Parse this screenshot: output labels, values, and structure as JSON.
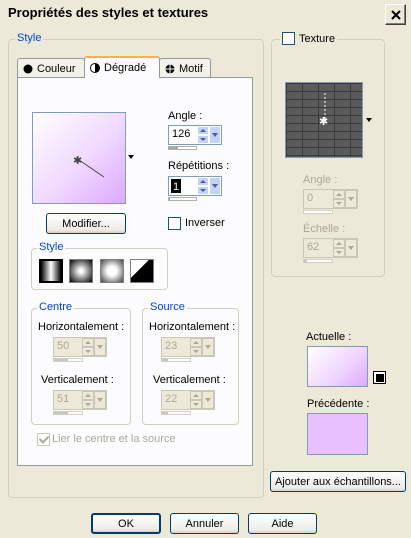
{
  "window": {
    "title": "Propriétés des styles et textures"
  },
  "style_group": {
    "label": "Style"
  },
  "tabs": [
    {
      "label": "Couleur",
      "icon": "circle-icon",
      "active": false
    },
    {
      "label": "Dégradé",
      "icon": "half-circle-icon",
      "active": true
    },
    {
      "label": "Motif",
      "icon": "pattern-icon",
      "active": false
    }
  ],
  "gradient": {
    "angle_label": "Angle :",
    "angle_value": "126",
    "repetitions_label": "Répétitions :",
    "repetitions_value": "1",
    "modify_button": "Modifier...",
    "invert_label": "Inverser",
    "invert_checked": false,
    "style_group_label": "Style",
    "styles": [
      "linear",
      "rectangular",
      "sunburst",
      "radial"
    ],
    "selected_style": "linear"
  },
  "centre": {
    "label": "Centre",
    "horizontal_label": "Horizontalement :",
    "horizontal_value": "50",
    "vertical_label": "Verticalement :",
    "vertical_value": "51"
  },
  "source": {
    "label": "Source",
    "horizontal_label": "Horizontalement :",
    "horizontal_value": "23",
    "vertical_label": "Verticalement :",
    "vertical_value": "22"
  },
  "link_center_source": {
    "label": "Lier le centre et la source",
    "checked": true,
    "enabled": false
  },
  "texture": {
    "label": "Texture",
    "checked": false,
    "angle_label": "Angle :",
    "angle_value": "0",
    "scale_label": "Échelle :",
    "scale_value": "62"
  },
  "current": {
    "label": "Actuelle :"
  },
  "previous": {
    "label": "Précédente :"
  },
  "buttons": {
    "add_swatch": "Ajouter aux échantillons...",
    "ok": "OK",
    "cancel": "Annuler",
    "help": "Aide"
  },
  "colors": {
    "accent_label": "#0046d5",
    "gradient_end": "#dcaaff",
    "previous_swatch": "#e8bfff"
  }
}
